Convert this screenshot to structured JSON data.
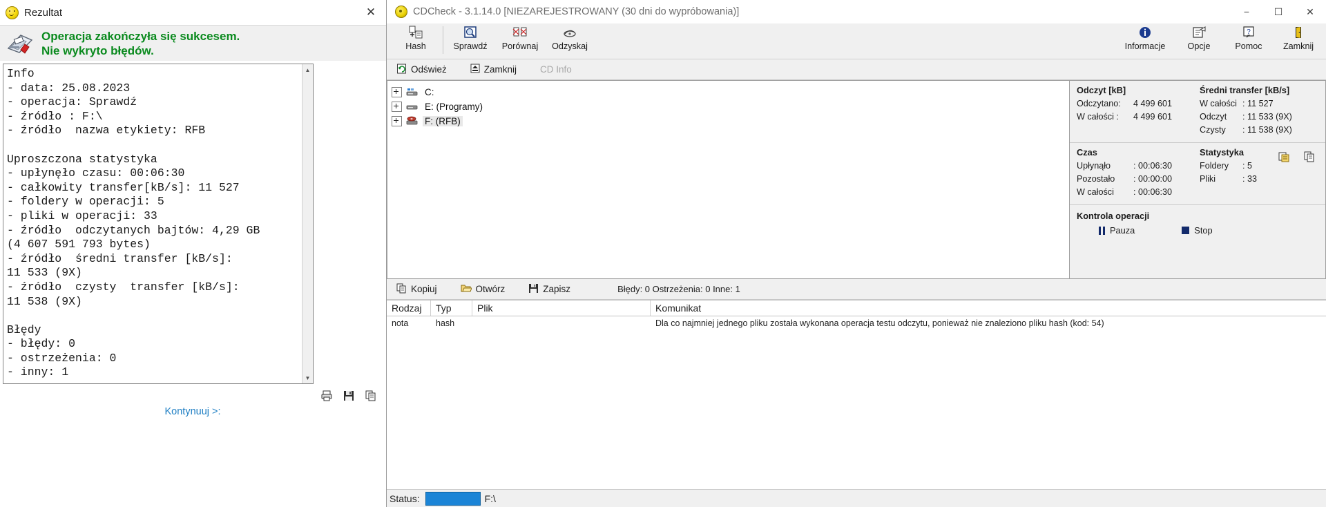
{
  "left_window": {
    "title": "Rezultat",
    "title_icon": "smiley-icon",
    "close_label": "✕",
    "banner_icon": "report-card-icon",
    "banner_line1": "Operacja zakończyła się sukcesem.",
    "banner_line2": "Nie wykryto błędów.",
    "banner_color": "#0a8a1e",
    "report_text": "Info\n- data: 25.08.2023\n- operacja: Sprawdź\n- źródło : F:\\\n- źródło  nazwa etykiety: RFB\n\nUproszczona statystyka\n- upłynęło czasu: 00:06:30\n- całkowity transfer[kB/s]: 11 527\n- foldery w operacji: 5\n- pliki w operacji: 33\n- źródło  odczytanych bajtów: 4,29 GB\n(4 607 591 793 bytes)\n- źródło  średni transfer [kB/s]:\n11 533 (9X)\n- źródło  czysty  transfer [kB/s]:\n11 538 (9X)\n\nBłędy\n- błędy: 0\n- ostrzeżenia: 0\n- inny: 1",
    "scroll_up": "▲",
    "scroll_down": "▼",
    "footer_icons": [
      "print-icon",
      "save-icon",
      "copy-icon"
    ],
    "continue_label": "Kontynuuj >:"
  },
  "cdcheck": {
    "title": "CDCheck - 3.1.14.0 [NIEZAREJESTROWANY (30 dni do wypróbowania)]",
    "title_icon": "cd-icon",
    "window_buttons": {
      "minimize": "−",
      "maximize": "☐",
      "close": "✕"
    },
    "toolbar_left": [
      {
        "label": "Hash",
        "icon": "hash-icon"
      },
      {
        "label": "Sprawdź",
        "icon": "check-disc-icon"
      },
      {
        "label": "Porównaj",
        "icon": "compare-icon"
      },
      {
        "label": "Odzyskaj",
        "icon": "recover-icon"
      }
    ],
    "toolbar_right": [
      {
        "label": "Informacje",
        "icon": "info-icon"
      },
      {
        "label": "Opcje",
        "icon": "options-icon"
      },
      {
        "label": "Pomoc",
        "icon": "help-icon"
      },
      {
        "label": "Zamknij",
        "icon": "exit-icon"
      }
    ],
    "toolbar2": [
      {
        "label": "Odśwież",
        "icon": "refresh-icon",
        "disabled": false
      },
      {
        "label": "Zamknij",
        "icon": "eject-icon",
        "disabled": false
      },
      {
        "label": "CD Info",
        "icon": "cdinfo-icon",
        "disabled": true
      }
    ],
    "tree": [
      {
        "label": "C:",
        "icon": "harddisk-icon",
        "selected": false
      },
      {
        "label": "E: (Programy)",
        "icon": "harddisk-icon",
        "selected": false
      },
      {
        "label": "F: (RFB)",
        "icon": "cddrive-icon",
        "selected": true
      }
    ],
    "stats": {
      "read_header": "Odczyt [kB]",
      "read_rows": [
        {
          "key": "Odczytano:",
          "value": "4 499 601"
        },
        {
          "key": "W całości  :",
          "value": "4 499 601"
        }
      ],
      "transfer_header": "Średni transfer [kB/s]",
      "transfer_rows": [
        {
          "key": "W całości",
          "value": ": 11 527"
        },
        {
          "key": "Odczyt",
          "value": ": 11 533 (9X)"
        },
        {
          "key": "Czysty",
          "value": ": 11 538 (9X)"
        }
      ],
      "time_header": "Czas",
      "time_rows": [
        {
          "key": "Upłynąło",
          "value": ": 00:06:30"
        },
        {
          "key": "Pozostało",
          "value": ": 00:00:00"
        },
        {
          "key": "W całości",
          "value": ": 00:06:30"
        }
      ],
      "statistics_header": "Statystyka",
      "statistics_rows": [
        {
          "key": "Foldery",
          "value": ": 5"
        },
        {
          "key": "Pliki",
          "value": ": 33"
        }
      ],
      "copy_icons": [
        "copy-report-icon",
        "copy-clipboard-icon"
      ]
    },
    "operation_control": {
      "header": "Kontrola operacji",
      "pause_label": "Pauza",
      "stop_label": "Stop",
      "glyph_color": "#132a6b"
    },
    "message_toolbar": [
      {
        "label": "Kopiuj",
        "icon": "copy-icon"
      },
      {
        "label": "Otwórz",
        "icon": "open-folder-icon"
      },
      {
        "label": "Zapisz",
        "icon": "save-icon"
      }
    ],
    "message_counts": "Błędy: 0 Ostrzeżenia: 0 Inne: 1",
    "message_table": {
      "columns": [
        "Rodzaj",
        "Typ",
        "Plik",
        "Komunikat"
      ],
      "rows": [
        {
          "rodzaj": "nota",
          "typ": "hash",
          "plik": "",
          "komunikat": "Dla co najmniej jednego pliku została wykonana operacja testu odczytu, ponieważ nie znaleziono pliku hash (kod: 54)"
        }
      ]
    },
    "statusbar": {
      "label": "Status:",
      "progress_color": "#1b84d6",
      "path": "F:\\"
    }
  }
}
